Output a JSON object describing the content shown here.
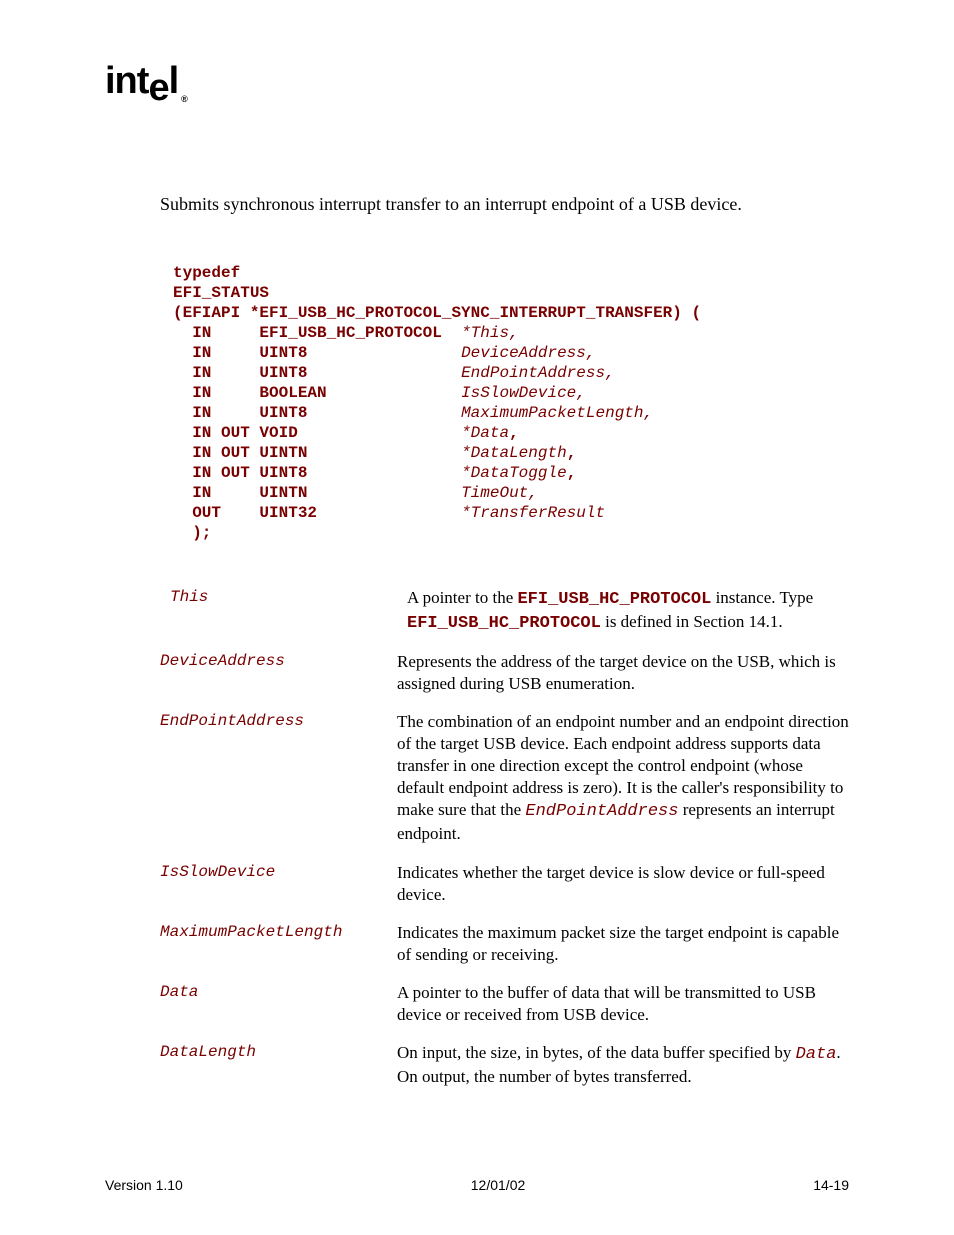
{
  "logo": {
    "text": "intel",
    "tm": "®"
  },
  "summary": "Submits synchronous interrupt transfer to an interrupt endpoint of a USB device.",
  "code": {
    "typedef": "typedef",
    "efi_status": "EFI_STATUS",
    "fn_open": "(EFIAPI *EFI_USB_HC_PROTOCOL_SYNC_INTERRUPT_TRANSFER) (",
    "p1_dir": "  IN     ",
    "p1_type": "EFI_USB_HC_PROTOCOL",
    "p1_pad": "  ",
    "p1_arg": "*This,",
    "p2_dir": "  IN     ",
    "p2_type": "UINT8",
    "p2_pad": "                ",
    "p2_arg": "DeviceAddress,",
    "p3_dir": "  IN     ",
    "p3_type": "UINT8",
    "p3_pad": "                ",
    "p3_arg": "EndPointAddress,",
    "p4_dir": "  IN     ",
    "p4_type": "BOOLEAN",
    "p4_pad": "              ",
    "p4_arg": "IsSlowDevice,",
    "p5_dir": "  IN     ",
    "p5_type": "UINT8",
    "p5_pad": "                ",
    "p5_arg": "MaximumPacketLength,",
    "p6_dir": "  IN OUT ",
    "p6_type": "VOID",
    "p6_pad": "                 ",
    "p6_arg": "*Data",
    "p6_comma": ",",
    "p7_dir": "  IN OUT ",
    "p7_type": "UINTN",
    "p7_pad": "                ",
    "p7_arg": "*DataLength",
    "p7_comma": ",",
    "p8_dir": "  IN OUT ",
    "p8_type": "UINT8",
    "p8_pad": "                ",
    "p8_arg": "*DataToggle",
    "p8_comma": ",",
    "p9_dir": "  IN     ",
    "p9_type": "UINTN",
    "p9_pad": "                ",
    "p9_arg": "TimeOut,",
    "p10_dir": "  OUT    ",
    "p10_type": "UINT32",
    "p10_pad": "               ",
    "p10_arg": "*TransferResult",
    "close": "  );"
  },
  "params": {
    "this": {
      "name": "This",
      "d1": "A pointer to the ",
      "d2": "EFI_USB_HC_PROTOCOL",
      "d3": " instance.  Type ",
      "d4": "EFI_USB_HC_PROTOCOL",
      "d5": " is defined in Section 14.1."
    },
    "deviceaddress": {
      "name": "DeviceAddress",
      "desc": "Represents the address of the target device on the USB, which is assigned during USB enumeration."
    },
    "endpointaddress": {
      "name": "EndPointAddress",
      "d1": "The combination of an endpoint number and an endpoint direction of the target USB device.  Each endpoint address supports data transfer in one direction except the control endpoint (whose default endpoint address is zero).  It is the caller's responsibility to make sure that the ",
      "d2": "EndPointAddress",
      "d3": " represents an interrupt endpoint."
    },
    "isslowdevice": {
      "name": "IsSlowDevice",
      "desc": "Indicates whether the target device is slow device or full-speed device."
    },
    "maximumpacketlength": {
      "name": "MaximumPacketLength",
      "desc": "Indicates the maximum packet size the target endpoint is capable of sending or receiving."
    },
    "data": {
      "name": "Data",
      "desc": "A pointer to the buffer of data that will be transmitted to USB device or received from USB device."
    },
    "datalength": {
      "name": "DataLength",
      "d1": "On input, the size, in bytes, of the data buffer specified by ",
      "d2": "Data",
      "d3": ". On output, the number of bytes transferred."
    }
  },
  "footer": {
    "left": "Version 1.10",
    "center": "12/01/02",
    "right": "14-19"
  }
}
